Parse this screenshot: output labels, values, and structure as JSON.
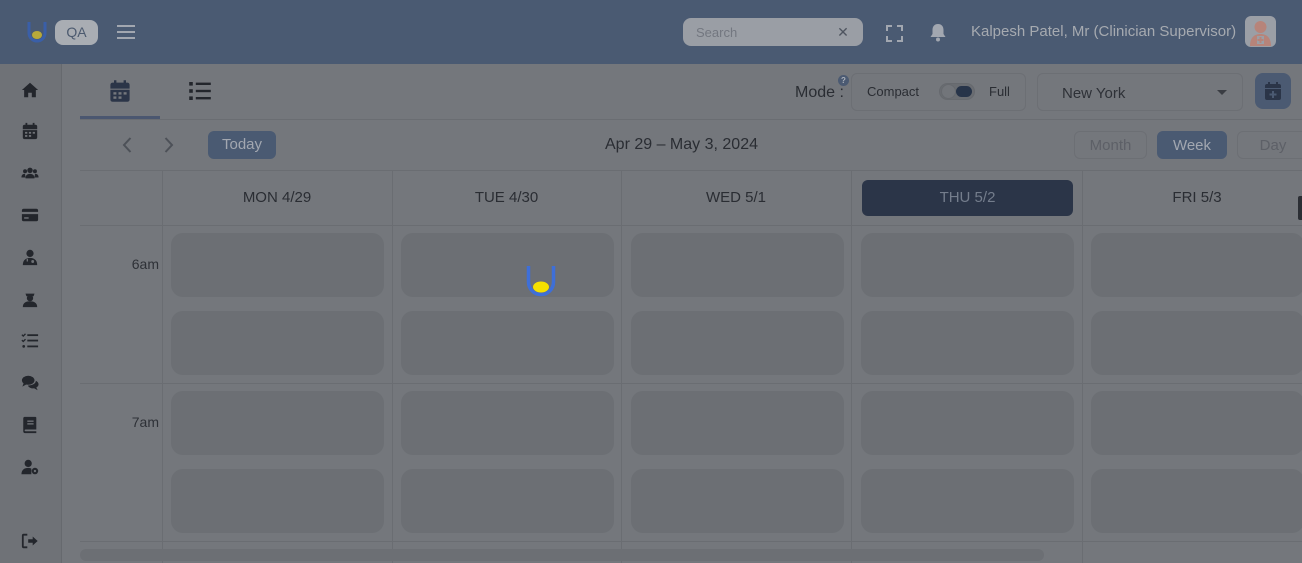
{
  "header": {
    "env_badge": "QA",
    "search_placeholder": "Search",
    "search_clear": "✕",
    "user_name": "Kalpesh Patel, Mr (Clinician Supervisor)"
  },
  "sidebar": {
    "items": [
      {
        "name": "home-icon"
      },
      {
        "name": "calendar-icon"
      },
      {
        "name": "users-icon"
      },
      {
        "name": "credit-card-icon"
      },
      {
        "name": "clinician-icon"
      },
      {
        "name": "staff-icon"
      },
      {
        "name": "task-list-icon"
      },
      {
        "name": "chat-icon"
      },
      {
        "name": "book-icon"
      },
      {
        "name": "user-settings-icon"
      },
      {
        "name": "logout-icon"
      }
    ]
  },
  "toolbar": {
    "mode_label": "Mode :",
    "mode_help": "?",
    "mode_compact": "Compact",
    "mode_full": "Full",
    "mode_value": "full",
    "timezone": "New York"
  },
  "calendar": {
    "today_label": "Today",
    "date_range": "Apr 29 – May 3, 2024",
    "views": [
      "Month",
      "Week",
      "Day"
    ],
    "selected_view": "Week",
    "days": [
      "MON 4/29",
      "TUE 4/30",
      "WED 5/1",
      "THU 5/2",
      "FRI 5/3"
    ],
    "today_index": 3,
    "time_labels": [
      "6am",
      "7am"
    ]
  },
  "colors": {
    "header_bg": "#4a5a72",
    "accent": "#4a5a72",
    "today_header": "#2b3548",
    "spinner_blue": "#3e6fd8",
    "spinner_yellow": "#f5e000"
  }
}
